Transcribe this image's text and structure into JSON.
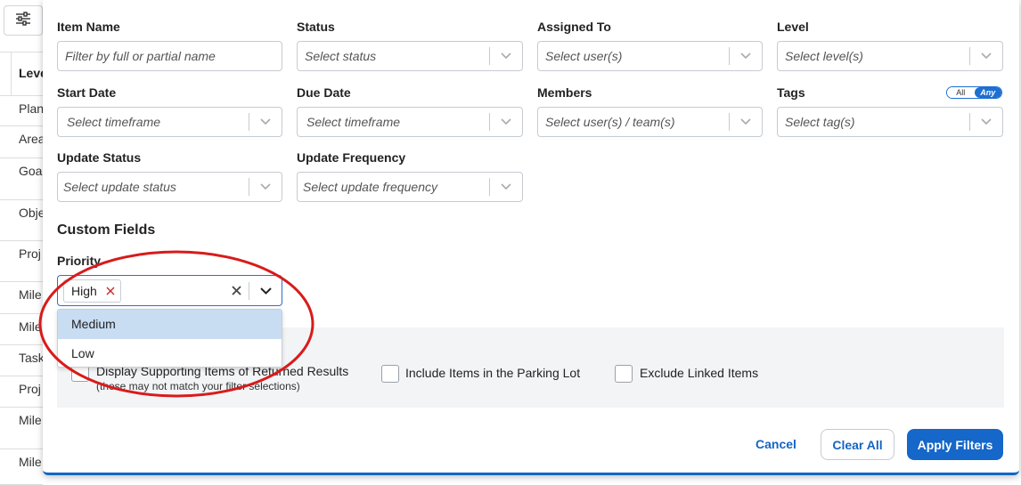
{
  "background": {
    "header_label": "Leve",
    "rows": [
      "Plan",
      "Area",
      "Goa",
      "Obje",
      "Proj",
      "Mile",
      "Mile",
      "Task",
      "Proj",
      "Mile",
      "Mile"
    ]
  },
  "filters": {
    "item_name": {
      "label": "Item Name",
      "placeholder": "Filter by full or partial name"
    },
    "status": {
      "label": "Status",
      "placeholder": "Select status"
    },
    "assigned_to": {
      "label": "Assigned To",
      "placeholder": "Select user(s)"
    },
    "level": {
      "label": "Level",
      "placeholder": "Select level(s)"
    },
    "start_date": {
      "label": "Start Date",
      "placeholder": "Select timeframe"
    },
    "due_date": {
      "label": "Due Date",
      "placeholder": "Select timeframe"
    },
    "members": {
      "label": "Members",
      "placeholder": "Select user(s) / team(s)"
    },
    "tags": {
      "label": "Tags",
      "placeholder": "Select tag(s)",
      "toggle_all": "All",
      "toggle_any": "Any"
    },
    "update_status": {
      "label": "Update Status",
      "placeholder": "Select update status"
    },
    "update_frequency": {
      "label": "Update Frequency",
      "placeholder": "Select update frequency"
    }
  },
  "custom_fields": {
    "title": "Custom Fields",
    "priority": {
      "label": "Priority",
      "selected": "High",
      "options": [
        "Medium",
        "Low"
      ]
    }
  },
  "options": {
    "supporting_items": "Display Supporting Items of Returned Results",
    "supporting_items_note": "(these may not match your filter selections)",
    "parking_lot": "Include Items in the Parking Lot",
    "exclude_linked": "Exclude Linked Items"
  },
  "actions": {
    "cancel": "Cancel",
    "clear_all": "Clear All",
    "apply": "Apply Filters"
  },
  "colors": {
    "accent": "#1567c9",
    "highlight": "#c8dcf2",
    "annotation": "#d81b1b"
  }
}
